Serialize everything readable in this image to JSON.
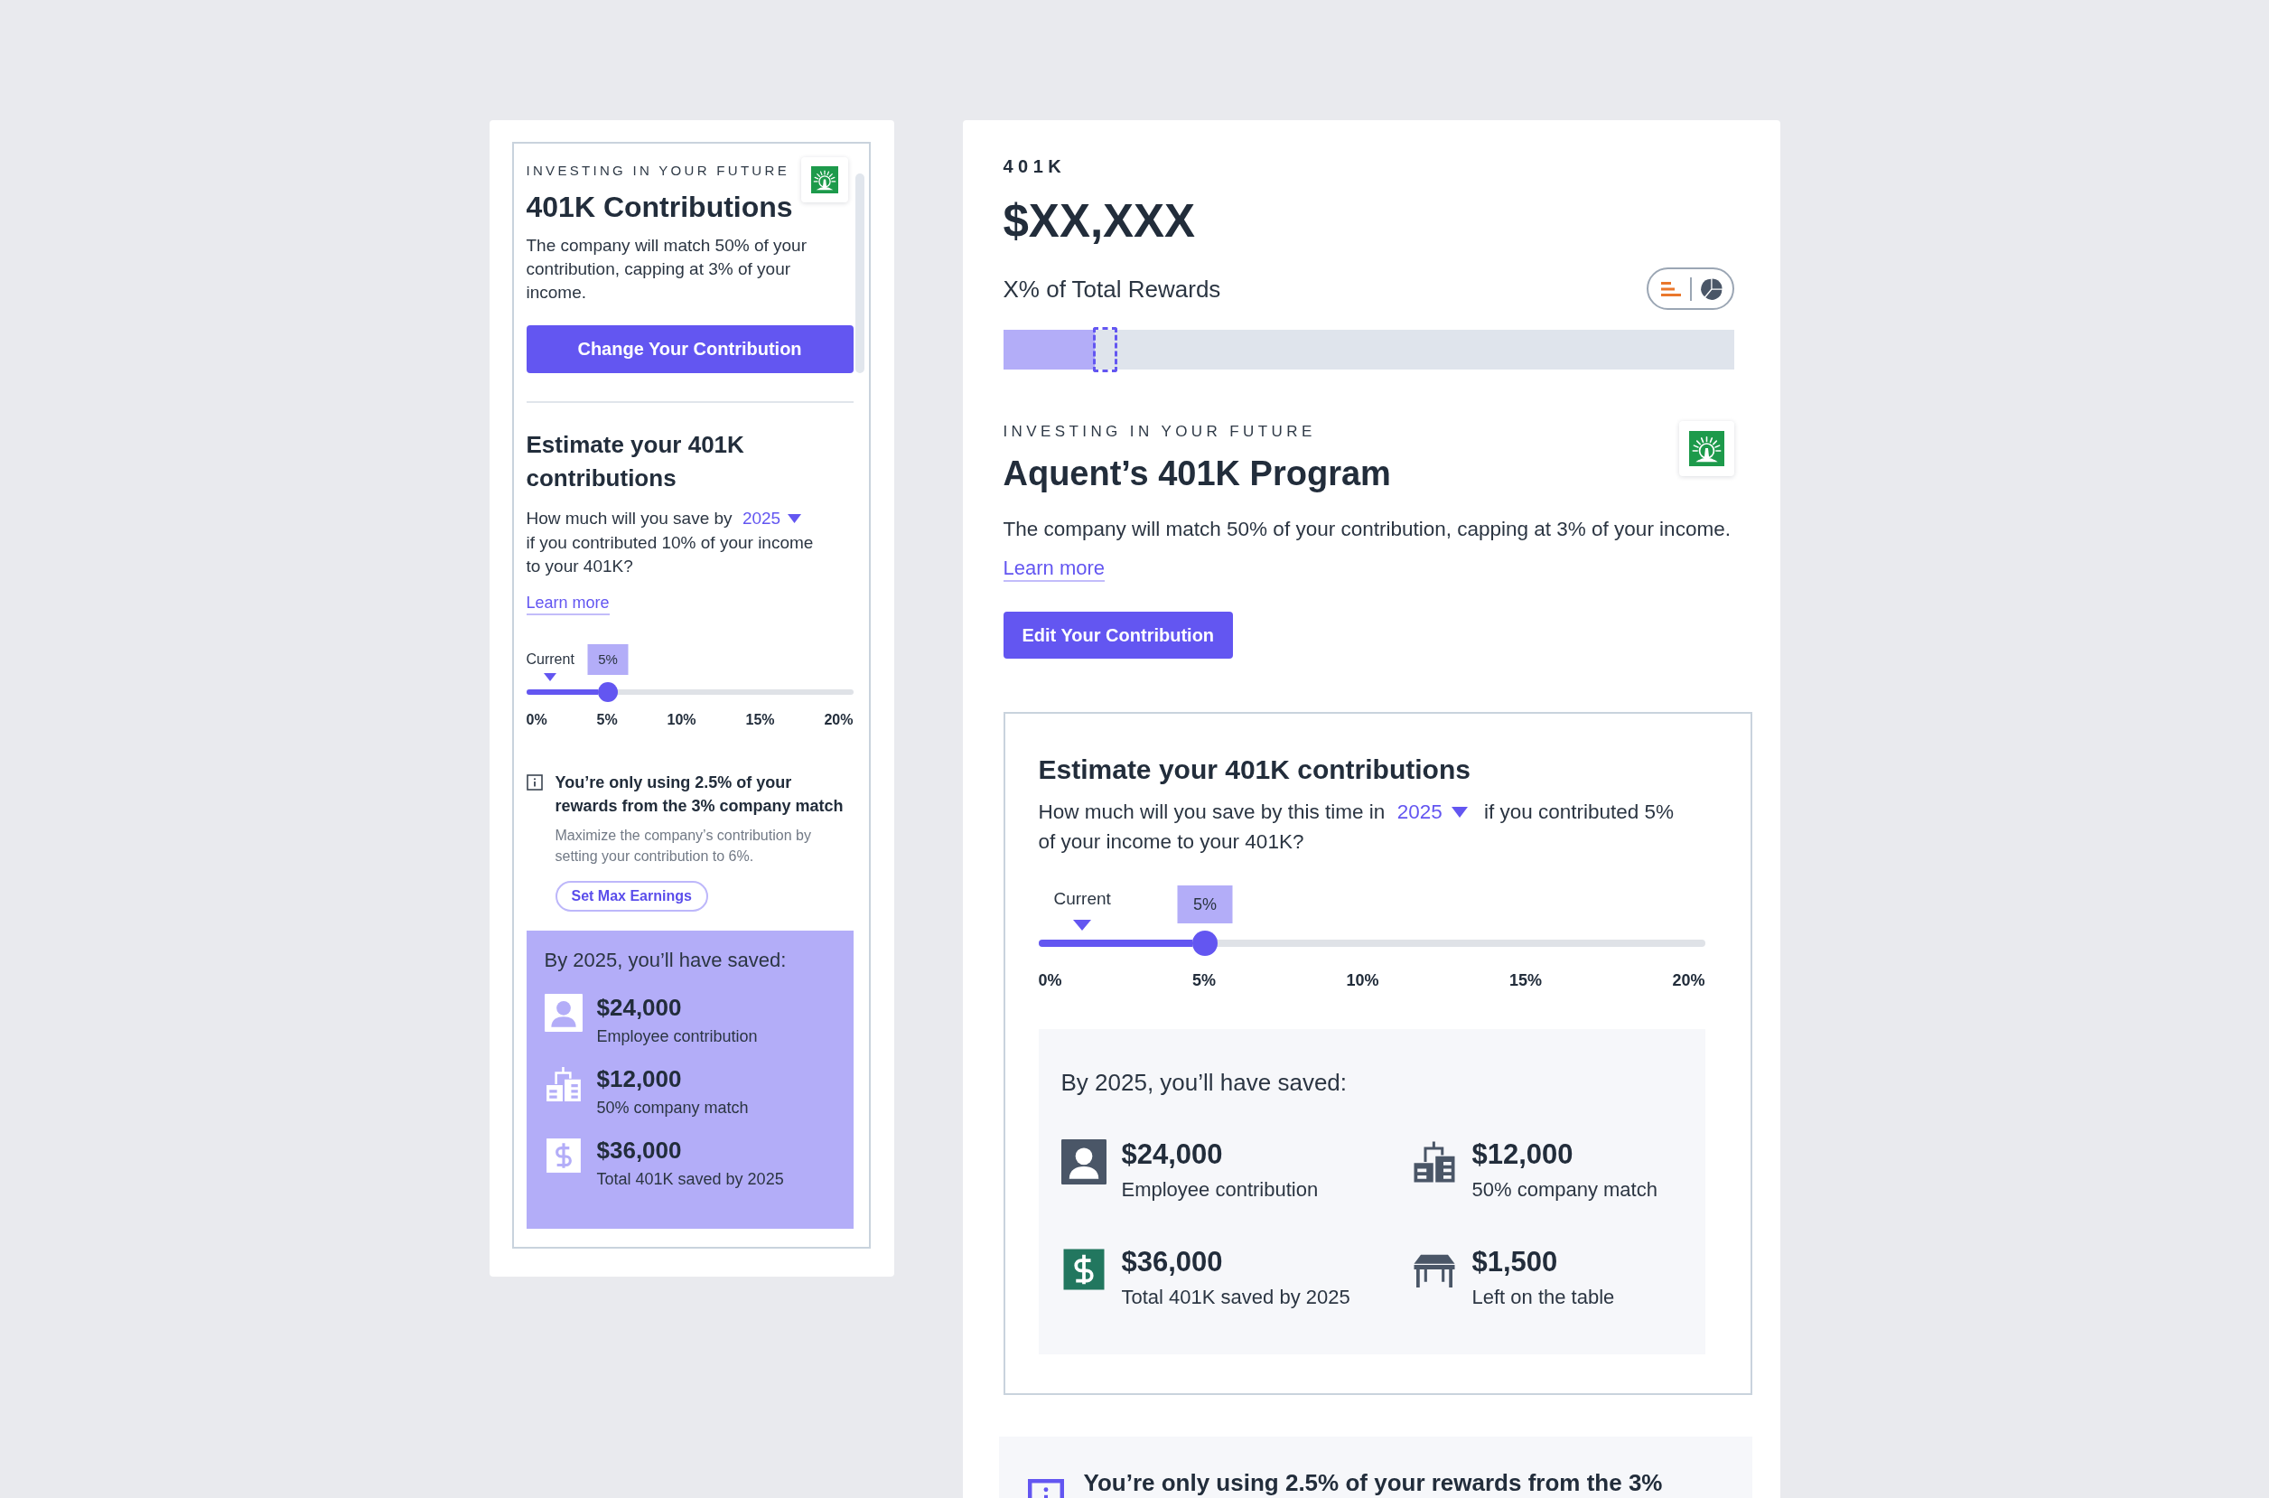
{
  "compact_card": {
    "eyebrow": "INVESTING IN YOUR FUTURE",
    "title": "401K Contributions",
    "description": "The company will match 50% of your contribution, capping at 3% of your income.",
    "button": "Change Your Contribution",
    "estimate": {
      "heading": "Estimate your 401K contributions",
      "question_start": "How much will you save by",
      "year": "2025",
      "question_end": "if you contributed 10% of your income to your 401K?",
      "link": "Learn more",
      "slider": {
        "current_label": "Current",
        "value_label": "5%",
        "level": 0.25,
        "ticks": [
          "0%",
          "5%",
          "10%",
          "15%",
          "20%"
        ]
      }
    },
    "notice": {
      "title": "You’re only using 2.5% of your rewards from the 3% company match",
      "body": "Maximize the company’s contribution by setting your contribution to 6%.",
      "button": "Set Max Earnings"
    },
    "summary": {
      "heading": "By 2025, you’ll have saved:",
      "items": [
        {
          "kind": "employee",
          "amount": "$24,000",
          "label": "Employee contribution"
        },
        {
          "kind": "company",
          "amount": "$12,000",
          "label": "50% company match"
        },
        {
          "kind": "total",
          "amount": "$36,000",
          "label": "Total 401K saved by 2025"
        }
      ]
    }
  },
  "full_card": {
    "eyebrow": "401K",
    "amount": "$XX,XXX",
    "share_label": "X% of Total Rewards",
    "view_toggle": [
      {
        "kind": "bars",
        "selected": true
      },
      {
        "kind": "pie",
        "selected": false
      }
    ],
    "rewards_bar": {
      "level": 0.125
    },
    "program": {
      "eyebrow": "INVESTING IN YOUR FUTURE",
      "title": "Aquent’s 401K Program",
      "description": "The company will match 50% of your contribution, capping at 3% of your income.",
      "link": "Learn more",
      "button": "Edit Your Contribution"
    },
    "estimate": {
      "heading": "Estimate your 401K contributions",
      "question_start": "How much will you save by this time in",
      "year": "2025",
      "question_end": "if you contributed 5% of your income to your 401K?",
      "slider": {
        "current_label": "Current",
        "value_label": "5%",
        "level": 0.25,
        "ticks": [
          "0%",
          "5%",
          "10%",
          "15%",
          "20%"
        ]
      }
    },
    "summary": {
      "heading": "By 2025, you’ll have saved:",
      "items": [
        {
          "kind": "employee",
          "amount": "$24,000",
          "label": "Employee contribution"
        },
        {
          "kind": "company",
          "amount": "$12,000",
          "label": "50% company match"
        },
        {
          "kind": "total",
          "amount": "$36,000",
          "label": "Total 401K saved by 2025"
        },
        {
          "kind": "left",
          "amount": "$1,500",
          "label": "Left on the table"
        }
      ]
    },
    "notice": {
      "title": "You’re only using 2.5% of your rewards from the 3%"
    }
  }
}
